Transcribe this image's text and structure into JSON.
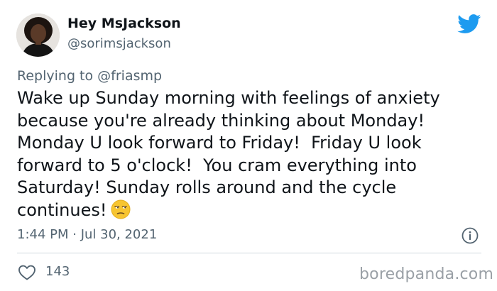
{
  "author": {
    "display_name": "Hey MsJackson",
    "handle": "@sorimsjackson",
    "avatar_icon": "profile-photo"
  },
  "reply": {
    "prefix": "Replying to",
    "mention": "@friasmp"
  },
  "tweet": {
    "lines": [
      "Wake up Sunday morning with feelings of anxiety",
      "because you're already thinking about Monday!",
      "Monday U look forward to Friday!  Friday U look",
      "forward to 5 o'clock!  You cram everything into",
      "Saturday! Sunday rolls around and the cycle",
      "continues!"
    ],
    "emoji": "unamused-face"
  },
  "meta": {
    "timestamp": "1:44 PM · Jul 30, 2021"
  },
  "actions": {
    "likes": "143"
  },
  "watermark": "boredpanda.com",
  "colors": {
    "twitter_blue": "#1d9bf0",
    "secondary_text": "#536471",
    "primary_text": "#0f1419",
    "divider": "#cfd9de",
    "emoji_yellow": "#f7c531"
  }
}
